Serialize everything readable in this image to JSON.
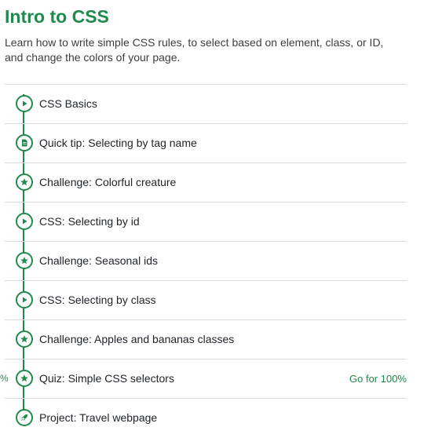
{
  "title": "Intro to CSS",
  "description": "Learn how to write simple CSS rules, to select based on element, class, or ID, and change the colors of your page.",
  "colors": {
    "accent": "#1f8a4c",
    "text": "#21242c",
    "divider": "#dcdcdc"
  },
  "items": [
    {
      "label": "CSS Basics",
      "icon": "play-icon"
    },
    {
      "label": "Quick tip: Selecting by tag name",
      "icon": "document-icon"
    },
    {
      "label": "Challenge: Colorful creature",
      "icon": "star-icon"
    },
    {
      "label": "CSS: Selecting by id",
      "icon": "play-icon"
    },
    {
      "label": "Challenge: Seasonal ids",
      "icon": "star-icon"
    },
    {
      "label": "CSS: Selecting by class",
      "icon": "play-icon"
    },
    {
      "label": "Challenge: Apples and bananas classes",
      "icon": "star-icon"
    },
    {
      "label": "Quiz: Simple CSS selectors",
      "icon": "star-icon",
      "goal": "Go for 100%",
      "side_text": "%"
    },
    {
      "label": "Project: Travel webpage",
      "icon": "rocket-icon"
    }
  ]
}
